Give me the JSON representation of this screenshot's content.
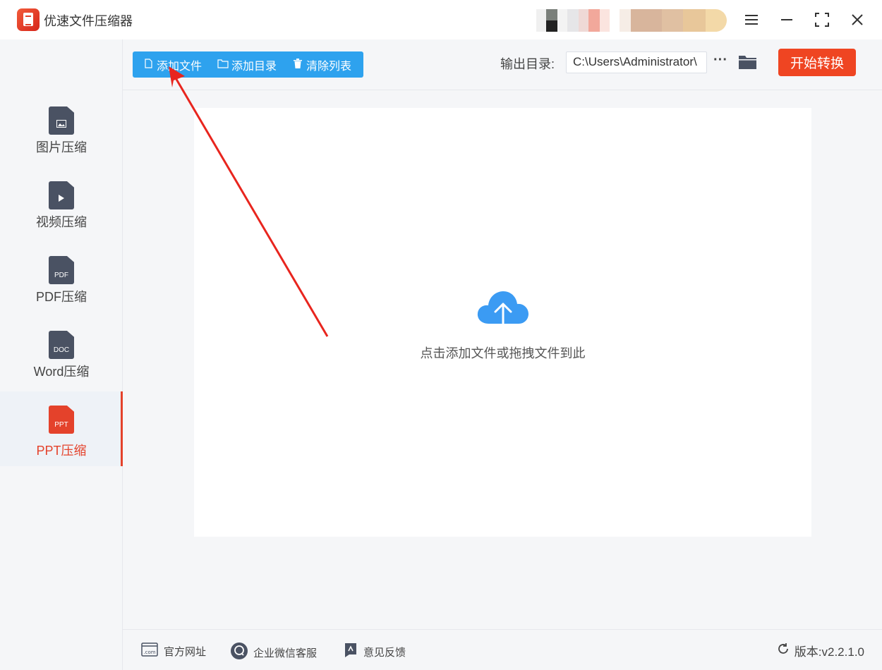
{
  "app": {
    "title": "优速文件压缩器"
  },
  "sidebar": {
    "items": [
      {
        "label": "图片压缩",
        "icon": "image-file-icon",
        "icon_text": "",
        "active": false
      },
      {
        "label": "视频压缩",
        "icon": "video-file-icon",
        "icon_text": "",
        "active": false
      },
      {
        "label": "PDF压缩",
        "icon": "pdf-file-icon",
        "icon_text": "PDF",
        "active": false
      },
      {
        "label": "Word压缩",
        "icon": "doc-file-icon",
        "icon_text": "DOC",
        "active": false
      },
      {
        "label": "PPT压缩",
        "icon": "ppt-file-icon",
        "icon_text": "PPT",
        "active": true
      }
    ]
  },
  "toolbar": {
    "add_file": "添加文件",
    "add_folder": "添加目录",
    "clear_list": "清除列表",
    "output_label": "输出目录:",
    "output_path": "C:\\Users\\Administrator\\",
    "more": "···",
    "start": "开始转换"
  },
  "dropzone": {
    "text": "点击添加文件或拖拽文件到此"
  },
  "footer": {
    "website": "官方网址",
    "website_icon_text": ".com",
    "wechat": "企业微信客服",
    "feedback": "意见反馈",
    "version": "版本:v2.2.1.0"
  },
  "colors": {
    "accent_red": "#ef4522",
    "toolbar_blue": "#2ea2ee",
    "cloud_blue": "#3b9bf3",
    "sidebar_icon": "#4a5263"
  }
}
